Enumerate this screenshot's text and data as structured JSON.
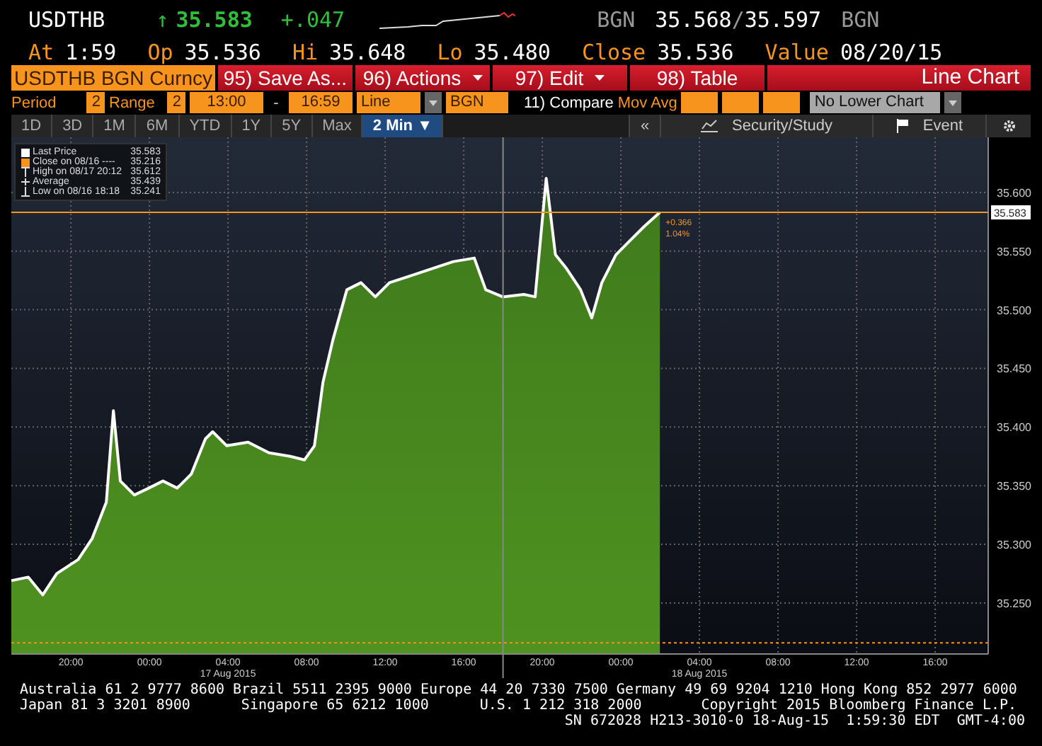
{
  "quote": {
    "ticker": "USDTHB",
    "arrow": "↑",
    "last": "35.583",
    "change": "+.047",
    "source": "BGN",
    "bid": "35.568",
    "separator": "/",
    "ask": "35.597",
    "source_2": "BGN"
  },
  "stats": [
    {
      "label": "At",
      "value": "1:59"
    },
    {
      "label": "Op",
      "value": "35.536"
    },
    {
      "label": "Hi",
      "value": "35.648"
    },
    {
      "label": "Lo",
      "value": "35.480"
    },
    {
      "label": "Close",
      "value": "35.536"
    },
    {
      "label": "Value",
      "value": "08/20/15"
    }
  ],
  "toolbar": {
    "security": "USDTHB BGN Curncy",
    "buttons": [
      {
        "label": "95) Save As...",
        "dropdown": false
      },
      {
        "label": "96) Actions",
        "dropdown": true
      },
      {
        "label": "97) Edit",
        "dropdown": true
      },
      {
        "label": "98) Table",
        "dropdown": false
      }
    ],
    "title": "Line Chart"
  },
  "settings": {
    "period_label": "Period",
    "period": "2",
    "range_label": "Range",
    "range": "2",
    "start": "13:00",
    "dash": "-",
    "end": "16:59",
    "chart_type": "Line",
    "pricing": "BGN",
    "compare": "11) Compare",
    "mov_avg_label": "Mov Avg",
    "lower_chart": "No Lower Chart"
  },
  "tabs": [
    {
      "label": "1D",
      "selected": false
    },
    {
      "label": "3D",
      "selected": false
    },
    {
      "label": "1M",
      "selected": false
    },
    {
      "label": "6M",
      "selected": false
    },
    {
      "label": "YTD",
      "selected": false
    },
    {
      "label": "1Y",
      "selected": false
    },
    {
      "label": "5Y",
      "selected": false
    },
    {
      "label": "Max",
      "selected": false
    },
    {
      "label": "2 Min ▼",
      "selected": true
    }
  ],
  "tools": {
    "collapse": "«",
    "security": "Security/Study",
    "event": "Event"
  },
  "legend": [
    {
      "kind": "series",
      "value": "35.583"
    },
    {
      "kind": "swatch",
      "color": "#f7941d",
      "label": "Close on 08/16 ----",
      "value": "35.216"
    },
    {
      "kind": "high",
      "label": "High on 08/17 20:12",
      "value": "35.612"
    },
    {
      "kind": "average",
      "label": "Average",
      "value": "35.439"
    },
    {
      "kind": "low",
      "label": "Low on 08/16 18:18",
      "value": "35.241"
    }
  ],
  "chart": {
    "price_tag": "35.583",
    "change_label": "+0.366",
    "change_pct": "1.04%",
    "date_labels": [
      "17 Aug 2015",
      "18 Aug 2015"
    ],
    "chart_data": {
      "type": "area",
      "grid": true,
      "xlim": [
        "2015-08-16T16:58",
        "2015-08-18T18:42"
      ],
      "ylim": [
        35.2065,
        35.647
      ],
      "ref_lines": [
        {
          "axis": "y",
          "value": 35.583,
          "color": "#f7941d"
        },
        {
          "axis": "y",
          "value": 35.216,
          "color": "#f7941d"
        },
        {
          "axis": "x",
          "value": "2015-08-17T18:00",
          "color": "#888888"
        }
      ],
      "xticks": [
        {
          "value": "2015-08-16T20:00",
          "label": "20:00"
        },
        {
          "value": "2015-08-17T00:00",
          "label": "00:00"
        },
        {
          "value": "2015-08-17T04:00",
          "label": "04:00"
        },
        {
          "value": "2015-08-17T08:00",
          "label": "08:00"
        },
        {
          "value": "2015-08-17T12:00",
          "label": "12:00"
        },
        {
          "value": "2015-08-17T16:00",
          "label": "16:00"
        },
        {
          "value": "2015-08-17T20:00",
          "label": "20:00"
        },
        {
          "value": "2015-08-18T00:00",
          "label": "00:00"
        },
        {
          "value": "2015-08-18T04:00",
          "label": "04:00"
        },
        {
          "value": "2015-08-18T08:00",
          "label": "08:00"
        },
        {
          "value": "2015-08-18T12:00",
          "label": "12:00"
        },
        {
          "value": "2015-08-18T16:00",
          "label": "16:00"
        }
      ],
      "yticks": [
        {
          "value": 35.25,
          "label": "35.250"
        },
        {
          "value": 35.3,
          "label": "35.300"
        },
        {
          "value": 35.35,
          "label": "35.350"
        },
        {
          "value": 35.4,
          "label": "35.400"
        },
        {
          "value": 35.45,
          "label": "35.450"
        },
        {
          "value": 35.5,
          "label": "35.500"
        },
        {
          "value": 35.55,
          "label": "35.550"
        },
        {
          "value": 35.6,
          "label": "35.600"
        }
      ],
      "x": [
        "2015-08-16T16:58",
        "2015-08-16T17:50",
        "2015-08-16T18:34",
        "2015-08-16T19:17",
        "2015-08-16T20:22",
        "2015-08-16T21:05",
        "2015-08-16T21:48",
        "2015-08-16T22:10",
        "2015-08-16T22:31",
        "2015-08-16T23:14",
        "2015-08-16T23:58",
        "2015-08-17T00:41",
        "2015-08-17T01:25",
        "2015-08-17T02:08",
        "2015-08-17T02:51",
        "2015-08-17T03:13",
        "2015-08-17T03:56",
        "2015-08-17T05:01",
        "2015-08-17T06:05",
        "2015-08-17T07:10",
        "2015-08-17T07:53",
        "2015-08-17T08:24",
        "2015-08-17T08:50",
        "2015-08-17T09:20",
        "2015-08-17T10:03",
        "2015-08-17T10:46",
        "2015-08-17T11:30",
        "2015-08-17T12:13",
        "2015-08-17T13:18",
        "2015-08-17T14:23",
        "2015-08-17T15:28",
        "2015-08-17T16:32",
        "2015-08-17T17:07",
        "2015-08-17T17:59",
        "2015-08-17T19:04",
        "2015-08-17T19:38",
        "2015-08-17T20:12",
        "2015-08-17T20:40",
        "2015-08-17T21:14",
        "2015-08-17T21:57",
        "2015-08-17T22:31",
        "2015-08-17T23:02",
        "2015-08-17T23:45",
        "2015-08-18T00:28",
        "2015-08-18T01:11",
        "2015-08-18T01:59"
      ],
      "series": [
        {
          "name": "Last Price",
          "color": "#ffffff",
          "values": [
            35.269,
            35.272,
            35.257,
            35.275,
            35.287,
            35.305,
            35.336,
            35.414,
            35.354,
            35.342,
            35.348,
            35.354,
            35.348,
            35.36,
            35.39,
            35.396,
            35.384,
            35.387,
            35.378,
            35.375,
            35.372,
            35.384,
            35.438,
            35.474,
            35.517,
            35.523,
            35.511,
            35.523,
            35.529,
            35.535,
            35.541,
            35.544,
            35.517,
            35.511,
            35.513,
            35.511,
            35.612,
            35.547,
            35.535,
            35.517,
            35.493,
            35.523,
            35.547,
            35.559,
            35.571,
            35.583
          ]
        }
      ]
    }
  },
  "footer": {
    "line_1": "Australia 61 2 9777 8600 Brazil 5511 2395 9000 Europe 44 20 7330 7500 Germany 49 69 9204 1210 Hong Kong 852 2977 6000",
    "line_2": [
      "Japan 81 3 3201 8900",
      "Singapore 65 6212 1000",
      "U.S. 1 212 318 2000",
      "Copyright 2015 Bloomberg Finance L.P."
    ],
    "line_3": "SN 672028 H213-3010-0 18-Aug-15  1:59:30 EDT  GMT-4:00"
  }
}
